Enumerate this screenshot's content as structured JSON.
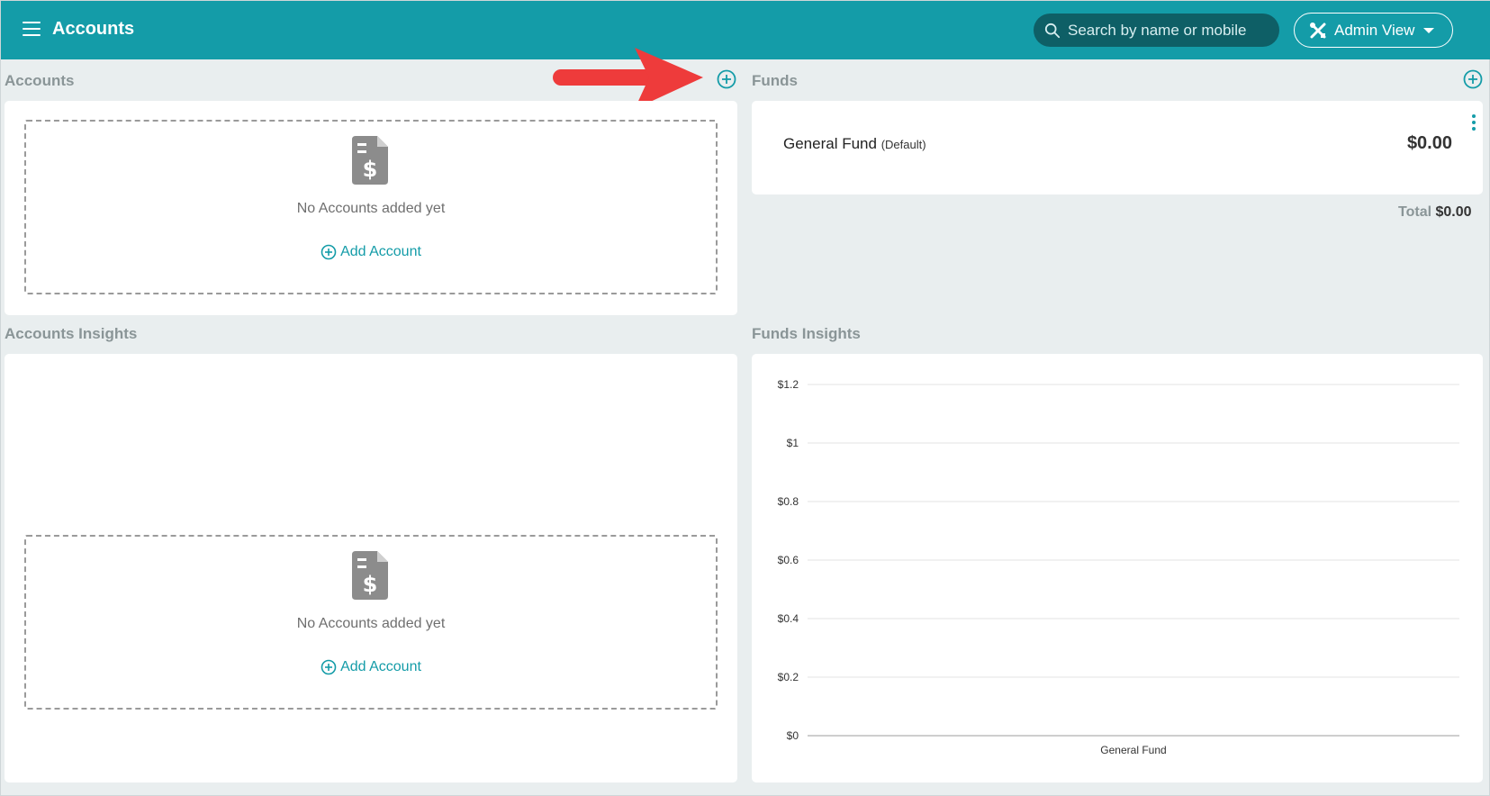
{
  "header": {
    "title": "Accounts",
    "search_placeholder": "Search by name or mobile",
    "admin_view_label": "Admin View"
  },
  "accounts": {
    "section_title": "Accounts",
    "empty_text": "No Accounts added yet",
    "add_label": "Add Account"
  },
  "funds": {
    "section_title": "Funds",
    "items": [
      {
        "name": "General Fund",
        "tag": "(Default)",
        "amount": "$0.00"
      }
    ],
    "total_label": "Total",
    "total_value": "$0.00"
  },
  "accounts_insights": {
    "section_title": "Accounts Insights",
    "empty_text": "No Accounts added yet",
    "add_label": "Add Account"
  },
  "funds_insights": {
    "section_title": "Funds Insights"
  },
  "chart_data": {
    "type": "bar",
    "categories": [
      "General Fund"
    ],
    "values": [
      0
    ],
    "title": "",
    "xlabel": "",
    "ylabel": "",
    "ylim": [
      0,
      1.2
    ],
    "yticks": [
      "$0",
      "$0.2",
      "$0.4",
      "$0.6",
      "$0.8",
      "$1",
      "$1.2"
    ],
    "grid": true
  },
  "colors": {
    "brand": "#149ca8",
    "annotation_arrow": "#ee3b3b"
  }
}
